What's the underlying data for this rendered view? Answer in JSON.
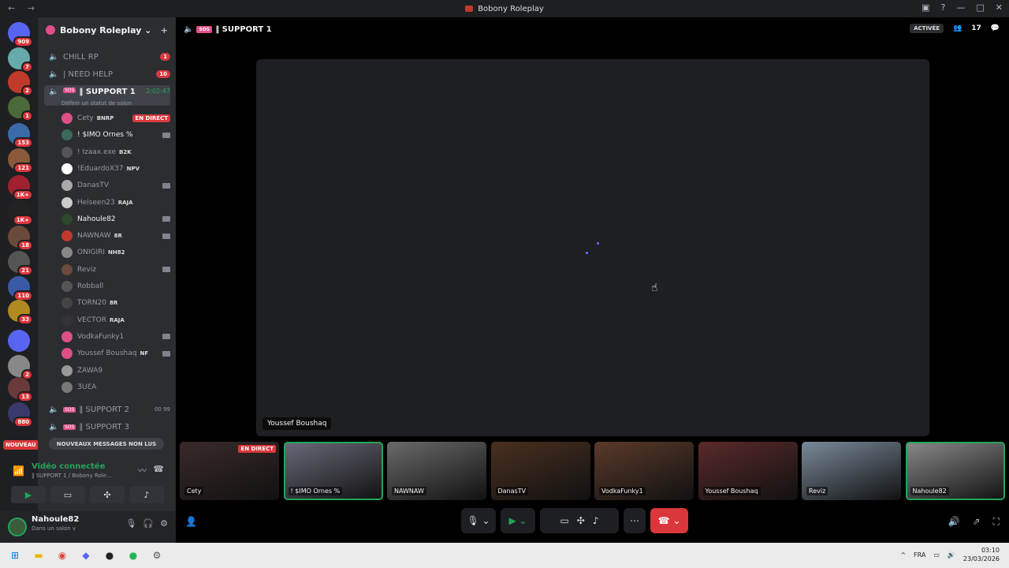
{
  "window": {
    "title": "Bobony Roleplay"
  },
  "servers": [
    {
      "badge": "909",
      "color": "#5865f2"
    },
    {
      "badge": "7",
      "color": "#6aa"
    },
    {
      "badge": "2",
      "color": "#c0392b"
    },
    {
      "badge": "1",
      "color": "#4a6a3a"
    },
    {
      "badge": "153",
      "color": "#3a6aa8"
    },
    {
      "badge": "121",
      "color": "#8a5a3a"
    },
    {
      "badge": "1K+",
      "color": "#a02030"
    },
    {
      "badge": "1K+",
      "color": "#222"
    },
    {
      "badge": "18",
      "color": "#6a4a3a"
    },
    {
      "badge": "21",
      "color": "#555"
    },
    {
      "badge": "110",
      "color": "#3a5aa8"
    },
    {
      "badge": "33",
      "color": "#b08a20"
    },
    {
      "badge": "",
      "color": "#5865f2"
    },
    {
      "badge": "2",
      "color": "#888"
    },
    {
      "badge": "13",
      "color": "#6a3a3a"
    },
    {
      "badge": "880",
      "color": "#3a3a6a"
    }
  ],
  "nouveau": "NOUVEAU",
  "guild": {
    "name": "Bobony Roleplay"
  },
  "channels": {
    "chill": {
      "name": "CHILL RP",
      "count": "1"
    },
    "needhelp": {
      "name": "| NEED HELP",
      "count": "10"
    },
    "support1": {
      "name": "‖ SUPPORT 1",
      "tag": "SOS",
      "timer": "2:02:47",
      "sub": "Définir un statut de salon"
    },
    "support2": {
      "name": "‖ SUPPORT 2",
      "tag": "SOS",
      "limit": "00 99"
    },
    "support3": {
      "name": "‖ SUPPORT 3",
      "tag": "SOS"
    }
  },
  "users": [
    {
      "name": "Cety",
      "extra": "BNRP",
      "live": "EN DIRECT"
    },
    {
      "name": "! $IMO Ornes %",
      "extra": ""
    },
    {
      "name": "! Izaax.exe",
      "extra": "B2K"
    },
    {
      "name": "!EduardoX37",
      "extra": "NPV"
    },
    {
      "name": "DanasTV",
      "extra": ""
    },
    {
      "name": "Heiseen23",
      "extra": "RAJA"
    },
    {
      "name": "Nahoule82",
      "extra": ""
    },
    {
      "name": "NAWNAW",
      "extra": "8R"
    },
    {
      "name": "ONIGIRI",
      "extra": "NH82"
    },
    {
      "name": "Reviz",
      "extra": ""
    },
    {
      "name": "Robball",
      "extra": ""
    },
    {
      "name": "TORN20",
      "extra": "8R"
    },
    {
      "name": "VECTOR",
      "extra": "RAJA"
    },
    {
      "name": "VodkaFunky1",
      "extra": ""
    },
    {
      "name": "Youssef Boushaq",
      "extra": "NF"
    },
    {
      "name": "ZAWA9",
      "extra": ""
    },
    {
      "name": "ƷUƐA",
      "extra": ""
    }
  ],
  "newmsg": "NOUVEAUX MESSAGES NON LUS",
  "voice": {
    "title": "Vidéo connectée",
    "sub": "‖ SUPPORT 1 / Bobony Role..."
  },
  "me": {
    "name": "Nahoule82",
    "status": "Dans un salon v"
  },
  "main": {
    "channel": "‖ SUPPORT 1",
    "tag": "SOS",
    "activee": "ACTIVÉE",
    "members": "17",
    "stage_label": "Youssef Boushaq",
    "tiles": [
      {
        "name": "Cety",
        "live": "EN DIRECT",
        "color": "#3a2a2a"
      },
      {
        "name": "! $IMO Ornes %",
        "color": "#6a6a7a"
      },
      {
        "name": "NAWNAW",
        "color": "#6a6a6a"
      },
      {
        "name": "DanasTV",
        "color": "#4a3020"
      },
      {
        "name": "VodkaFunky1",
        "color": "#5a3a2a"
      },
      {
        "name": "Youssef Boushaq",
        "color": "#5a2a2a"
      },
      {
        "name": "Reviz",
        "color": "#7a8a9a"
      },
      {
        "name": "Nahoule82",
        "color": "#8a8a8a"
      }
    ]
  },
  "taskbar": {
    "lang": "FRA",
    "time": "03:10",
    "date": "23/03/2026"
  }
}
